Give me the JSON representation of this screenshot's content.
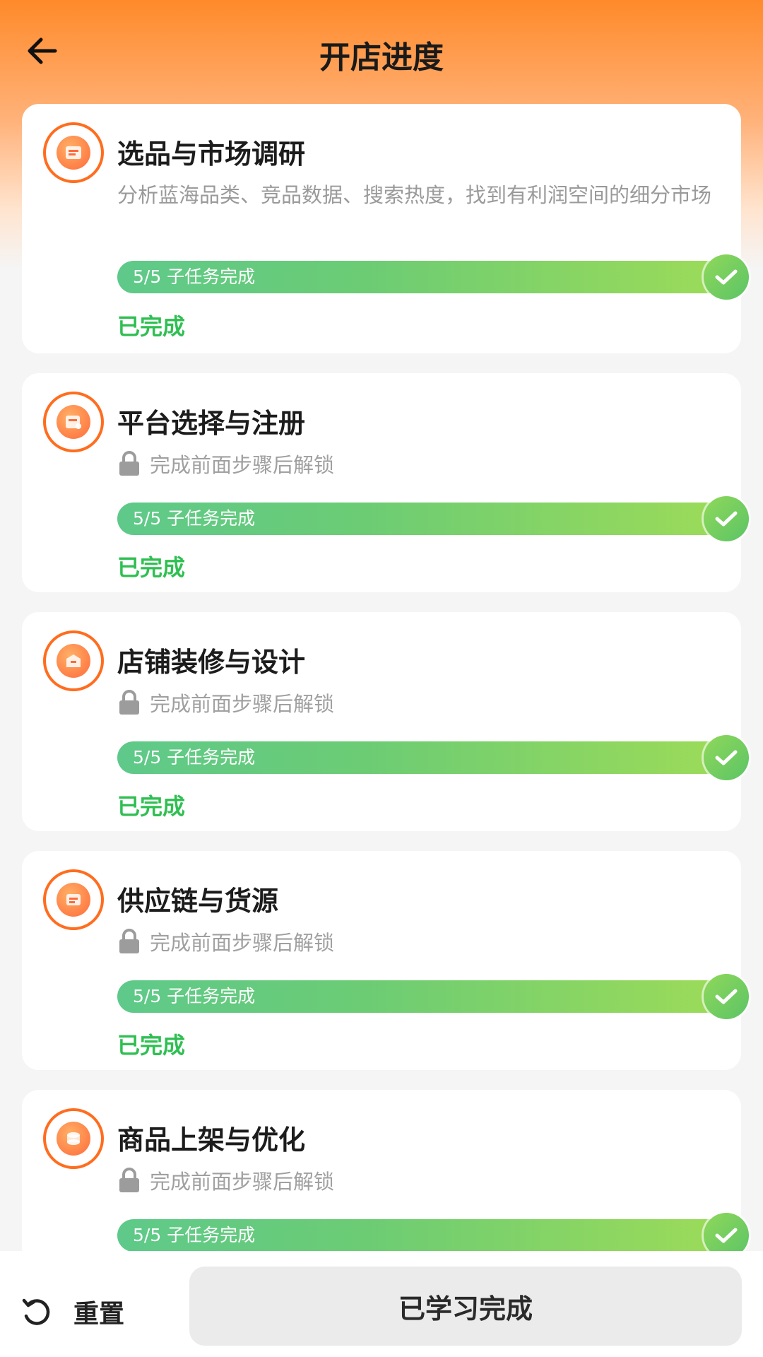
{
  "header": {
    "title": "开店进度",
    "back_icon": "arrow-left-icon"
  },
  "colors": {
    "accent": "#ff6d1f",
    "success": "#2fbf52",
    "progress_start": "#5ec98a",
    "progress_end": "#9fdc57"
  },
  "steps": [
    {
      "title": "选品与市场调研",
      "description": "分析蓝海品类、竞品数据、搜索热度，找到有利润空间的细分市场",
      "progress_text": "5/5 子任务完成",
      "progress": 1.0,
      "status": "已完成",
      "icon": "research-icon"
    },
    {
      "title": "平台选择与注册",
      "locked_text": "完成前面步骤后解锁",
      "progress_text": "5/5 子任务完成",
      "progress": 1.0,
      "status": "已完成",
      "icon": "register-icon"
    },
    {
      "title": "店铺装修与设计",
      "locked_text": "完成前面步骤后解锁",
      "progress_text": "5/5 子任务完成",
      "progress": 1.0,
      "status": "已完成",
      "icon": "design-icon"
    },
    {
      "title": "供应链与货源",
      "locked_text": "完成前面步骤后解锁",
      "progress_text": "5/5 子任务完成",
      "progress": 1.0,
      "status": "已完成",
      "icon": "supply-icon"
    },
    {
      "title": "商品上架与优化",
      "locked_text": "完成前面步骤后解锁",
      "progress_text": "5/5 子任务完成",
      "progress": 1.0,
      "icon": "listing-icon"
    }
  ],
  "footer": {
    "reset_label": "重置",
    "done_label": "已学习完成"
  }
}
